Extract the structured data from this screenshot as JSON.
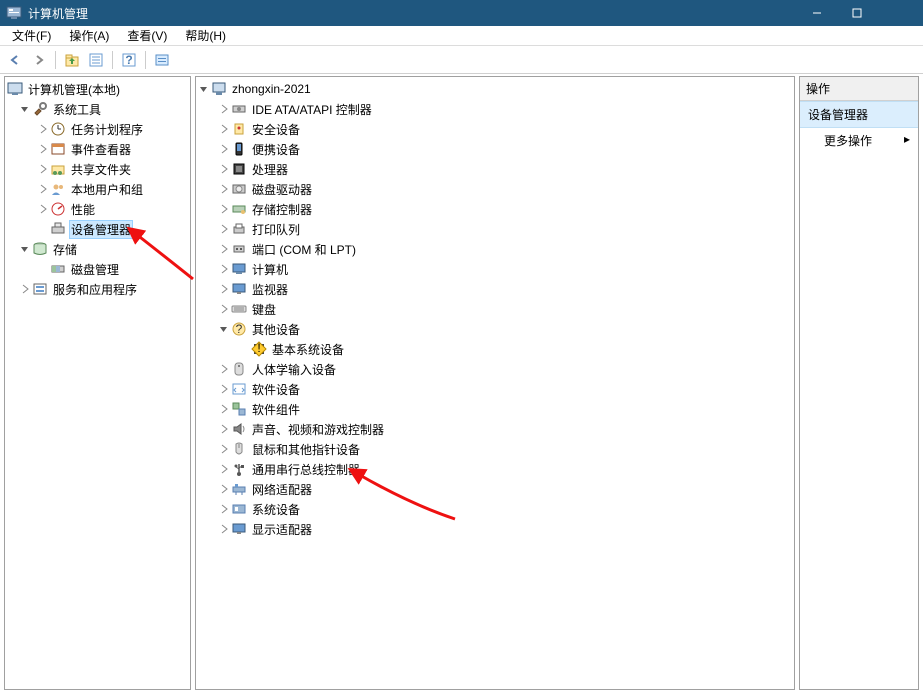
{
  "window": {
    "title": "计算机管理"
  },
  "menu": {
    "file": "文件(F)",
    "action": "操作(A)",
    "view": "查看(V)",
    "help": "帮助(H)"
  },
  "left_tree": {
    "root": "计算机管理(本地)",
    "system_tools": "系统工具",
    "task_scheduler": "任务计划程序",
    "event_viewer": "事件查看器",
    "shared_folders": "共享文件夹",
    "local_users": "本地用户和组",
    "performance": "性能",
    "device_manager": "设备管理器",
    "storage": "存储",
    "disk_mgmt": "磁盘管理",
    "services": "服务和应用程序"
  },
  "center_tree": {
    "root": "zhongxin-2021",
    "ide": "IDE ATA/ATAPI 控制器",
    "security": "安全设备",
    "portable": "便携设备",
    "processor": "处理器",
    "disk": "磁盘驱动器",
    "storage_ctrl": "存储控制器",
    "print_queue": "打印队列",
    "ports": "端口 (COM 和 LPT)",
    "computer": "计算机",
    "monitor": "监视器",
    "keyboard": "键盘",
    "other": "其他设备",
    "base_system": "基本系统设备",
    "hid": "人体学输入设备",
    "software_dev": "软件设备",
    "software_comp": "软件组件",
    "audio": "声音、视频和游戏控制器",
    "mouse": "鼠标和其他指针设备",
    "usb": "通用串行总线控制器",
    "network": "网络适配器",
    "system_dev": "系统设备",
    "display": "显示适配器"
  },
  "right": {
    "header": "操作",
    "selected": "设备管理器",
    "more": "更多操作"
  }
}
